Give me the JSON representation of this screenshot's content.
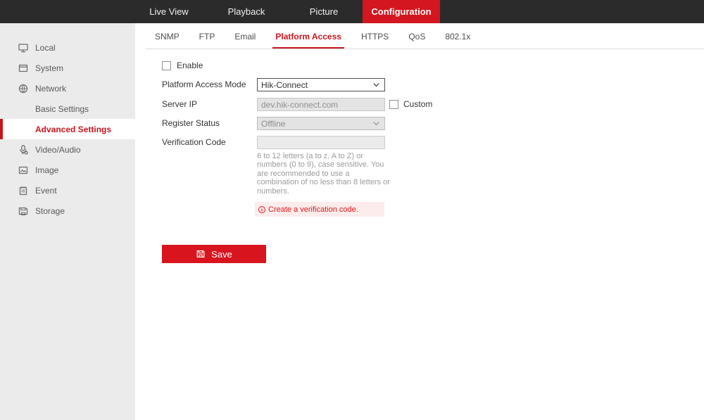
{
  "top_nav": {
    "items": [
      {
        "label": "Live View",
        "active": false
      },
      {
        "label": "Playback",
        "active": false
      },
      {
        "label": "Picture",
        "active": false
      },
      {
        "label": "Configuration",
        "active": true
      }
    ]
  },
  "sidebar": {
    "items": [
      {
        "label": "Local",
        "icon": "monitor-icon",
        "type": "top"
      },
      {
        "label": "System",
        "icon": "window-icon",
        "type": "top"
      },
      {
        "label": "Network",
        "icon": "globe-icon",
        "type": "top"
      },
      {
        "label": "Basic Settings",
        "type": "sub",
        "active": false
      },
      {
        "label": "Advanced Settings",
        "type": "sub",
        "active": true
      },
      {
        "label": "Video/Audio",
        "icon": "microphone-icon",
        "type": "top"
      },
      {
        "label": "Image",
        "icon": "image-icon",
        "type": "top"
      },
      {
        "label": "Event",
        "icon": "notepad-icon",
        "type": "top"
      },
      {
        "label": "Storage",
        "icon": "floppy-icon",
        "type": "top"
      }
    ]
  },
  "tabs": {
    "items": [
      {
        "label": "SNMP",
        "active": false
      },
      {
        "label": "FTP",
        "active": false
      },
      {
        "label": "Email",
        "active": false
      },
      {
        "label": "Platform Access",
        "active": true
      },
      {
        "label": "HTTPS",
        "active": false
      },
      {
        "label": "QoS",
        "active": false
      },
      {
        "label": "802.1x",
        "active": false
      }
    ]
  },
  "form": {
    "enable": {
      "label": "Enable",
      "checked": false
    },
    "platform_access_mode": {
      "label": "Platform Access Mode",
      "value": "Hik-Connect",
      "disabled": false
    },
    "server_ip": {
      "label": "Server IP",
      "value": "dev.hik-connect.com",
      "disabled": true
    },
    "custom": {
      "label": "Custom",
      "checked": false
    },
    "register_status": {
      "label": "Register Status",
      "value": "Offline",
      "disabled": true
    },
    "verification_code": {
      "label": "Verification Code",
      "value": ""
    },
    "hint": "6 to 12 letters (a to z, A to Z) or numbers (0 to 9), case sensitive. You are recommended to use a combination of no less than 8 letters or numbers.",
    "warning": "Create a verification code.",
    "save_label": "Save"
  },
  "colors": {
    "topbar_bg": "#2b2b2b",
    "accent_red": "#d3161f",
    "active_text_red": "#c9161d",
    "sidebar_bg": "#ebebeb",
    "warning_bg": "#fcecec",
    "warning_text": "#e31717",
    "disabled_bg": "#e4e4e4",
    "hint_text": "#9b9b9b"
  }
}
